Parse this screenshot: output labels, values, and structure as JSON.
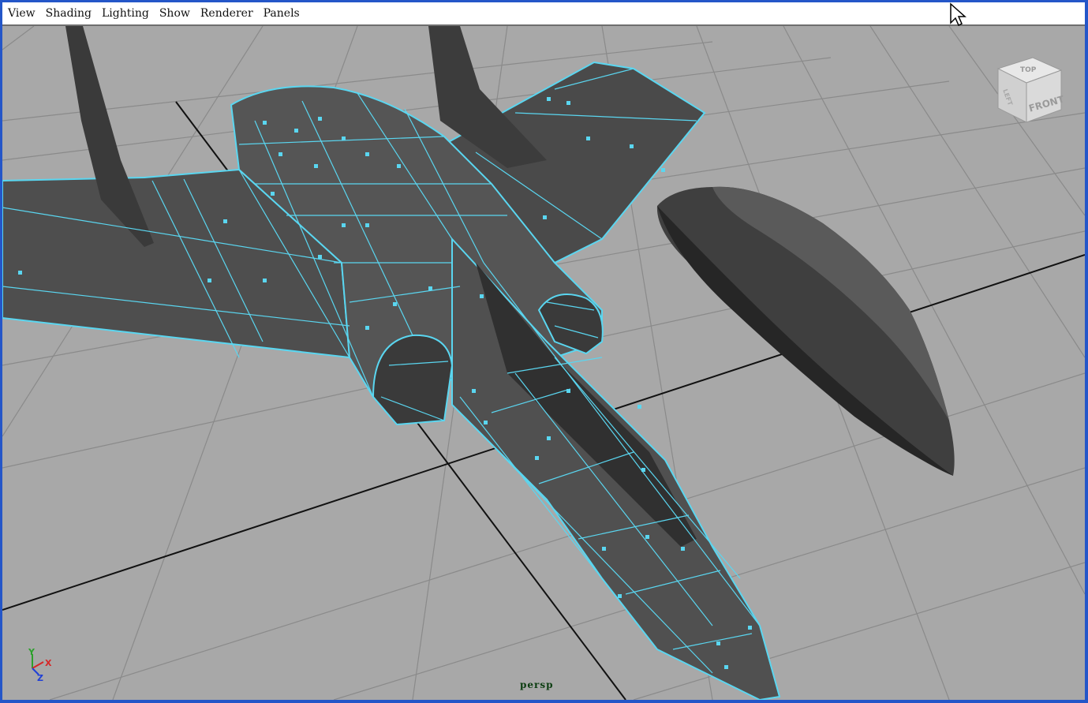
{
  "menubar": {
    "items": [
      "View",
      "Shading",
      "Lighting",
      "Show",
      "Renderer",
      "Panels"
    ]
  },
  "viewport": {
    "camera_label": "persp",
    "view_cube": {
      "top_label": "TOP",
      "front_label": "FRONT",
      "left_label": "LEFT"
    },
    "axis_gizmo": {
      "x_label": "X",
      "y_label": "Y",
      "z_label": "Z"
    },
    "colors": {
      "background": "#a8a8a8",
      "grid": "#8c8c8c",
      "grid_axis": "#111111",
      "mesh": "#4d4d4d",
      "selection_wire": "#5ad6f0"
    }
  }
}
